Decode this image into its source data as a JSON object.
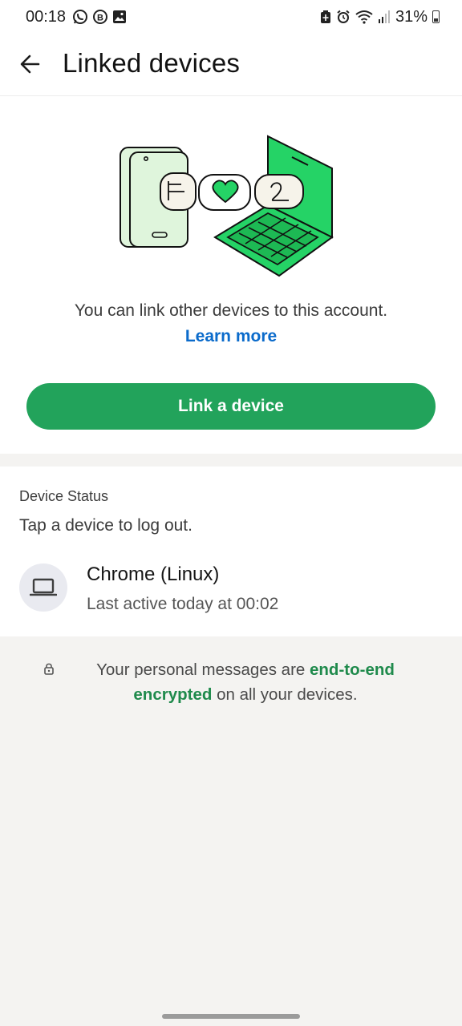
{
  "status_bar": {
    "time": "00:18",
    "battery_text": "31%",
    "left_icons": [
      "whatsapp-icon",
      "business-icon",
      "gallery-icon"
    ],
    "right_icons": [
      "battery-saver-icon",
      "alarm-icon",
      "wifi-icon",
      "signal-icon",
      "battery-icon"
    ]
  },
  "app_bar": {
    "title": "Linked devices",
    "back_icon": "arrow-left-icon"
  },
  "intro": {
    "description": "You can link other devices to this account.",
    "learn_more": "Learn more",
    "button_label": "Link a device"
  },
  "device_status": {
    "title": "Device Status",
    "subtitle": "Tap a device to log out.",
    "devices": [
      {
        "name": "Chrome (Linux)",
        "last_active": "Last active today at 00:02",
        "icon": "laptop-icon"
      }
    ]
  },
  "encryption": {
    "prefix": "Your personal messages are ",
    "highlight": "end-to-end encrypted",
    "suffix": " on all your devices."
  },
  "colors": {
    "accent": "#22a35b",
    "link": "#0b6bcb",
    "highlight_green": "#1f8a4c"
  }
}
